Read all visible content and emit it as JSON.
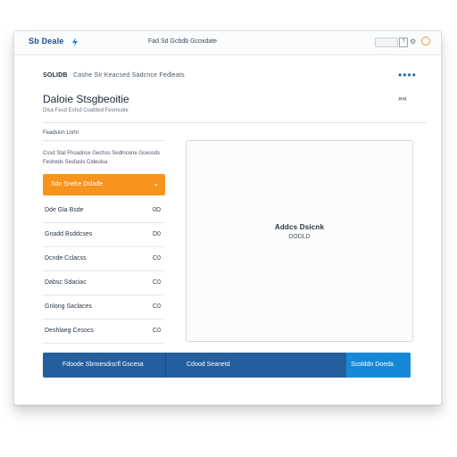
{
  "topbar": {
    "logo_text": "Sb Deale",
    "title": "Fad Sd Gcbdb Gcoxdate",
    "search_icon": "search-icon",
    "help_icon": "help-icon",
    "gear_icon": "gear-icon",
    "status_icon": "status-ring-icon",
    "accent": "#f29a1f"
  },
  "breadcrumb": {
    "root": "SOLIDB",
    "path": "Cashe Slr Keacsed Sadcnce Fedleats"
  },
  "page": {
    "title": "Daloie Stsgbeoitie",
    "subtitle": "Dlsa Fesd Esfsd Coabted Fesmcele",
    "more_icon": "more-dots-icon",
    "collapse_label": "»«"
  },
  "left_panel": {
    "section_label": "Feadsion Lnrtn",
    "description": "Cssd Stal Fhsadnce Gechss Sedlncone Gceosds Fesheds Sesfasls Cldeulsa",
    "dropdown": {
      "label": "Sdn Sneke Dslade",
      "color": "#f7941d"
    },
    "items": [
      {
        "name": "Dde Gla Bsde",
        "value": "0D"
      },
      {
        "name": "Gnadd Bsddcses",
        "value": "D0"
      },
      {
        "name": "Dcnde Cclacss",
        "value": "C0"
      },
      {
        "name": "Dabsc Sdaciac",
        "value": "C0"
      },
      {
        "name": "Gnlong Saclaces",
        "value": "C0"
      },
      {
        "name": "Deshlaeg Cesocs",
        "value": "C0"
      }
    ]
  },
  "preview": {
    "title": "Addcs Dsicnk",
    "subtitle": "DODLD"
  },
  "bottom_bar": {
    "segment1": "Fdoode Sbnsesdiscfl Gscesa",
    "segment2": "Cdood Seanetd",
    "segment3": "Scolddn Doeda",
    "color_main": "#235f9e",
    "color_accent": "#1589d8"
  }
}
